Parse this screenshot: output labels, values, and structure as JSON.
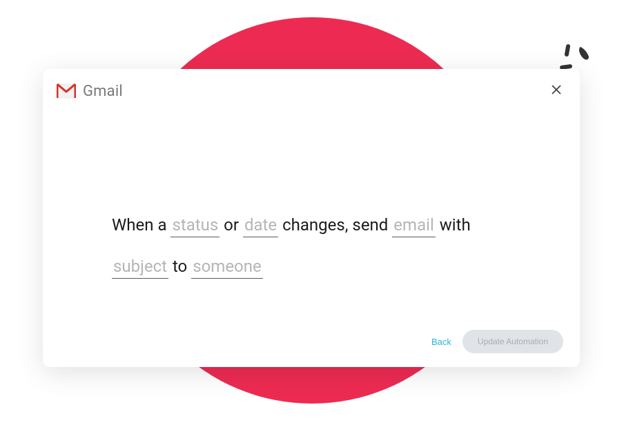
{
  "header": {
    "brand_label": "Gmail"
  },
  "sentence": {
    "t1": "When a ",
    "token_status": "status",
    "t2": " or ",
    "token_date": "date",
    "t3": " changes,  send ",
    "token_email": "email",
    "t4": " with ",
    "token_subject": "subject",
    "t5": " to ",
    "token_someone": "someone"
  },
  "footer": {
    "back_label": "Back",
    "update_label": "Update Automation"
  },
  "colors": {
    "accent_red": "#ed2b52",
    "link_teal": "#2bb4d6"
  }
}
